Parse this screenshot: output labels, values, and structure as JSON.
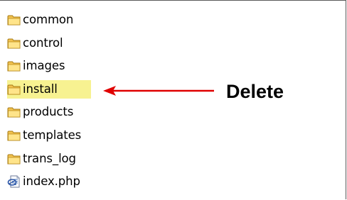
{
  "files": [
    {
      "name": "common",
      "type": "folder-icon",
      "highlighted": false
    },
    {
      "name": "control",
      "type": "folder-icon",
      "highlighted": false
    },
    {
      "name": "images",
      "type": "folder-icon",
      "highlighted": false
    },
    {
      "name": "install",
      "type": "folder-icon",
      "highlighted": true
    },
    {
      "name": "products",
      "type": "folder-icon",
      "highlighted": false
    },
    {
      "name": "templates",
      "type": "folder-icon",
      "highlighted": false
    },
    {
      "name": "trans_log",
      "type": "folder-icon",
      "highlighted": false
    },
    {
      "name": "index.php",
      "type": "php-file-icon",
      "highlighted": false
    }
  ],
  "annotation": {
    "label": "Delete",
    "arrow_color": "#e00000",
    "highlight_color": "#f7f291"
  }
}
